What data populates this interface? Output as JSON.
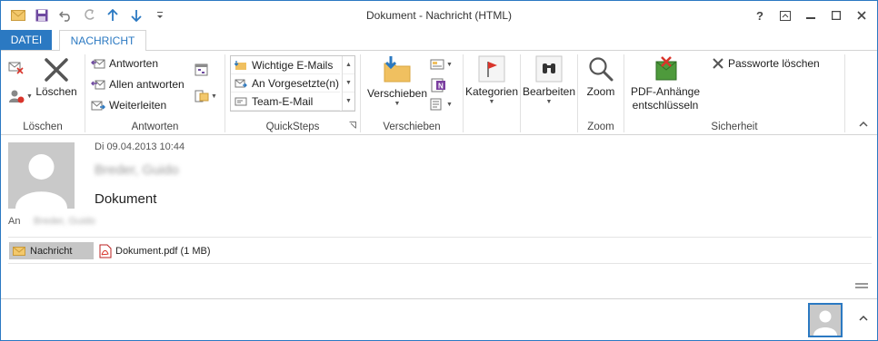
{
  "window": {
    "title": "Dokument - Nachricht (HTML)",
    "controls": {
      "help": "?",
      "restore_ribbon": "⇱",
      "minimize": "—",
      "maximize": "☐",
      "close": "✕"
    }
  },
  "tabs": {
    "file": "DATEI",
    "message": "NACHRICHT"
  },
  "ribbon": {
    "loeschen": {
      "delete_label": "Löschen",
      "group": "Löschen"
    },
    "antworten": {
      "reply": "Antworten",
      "reply_all": "Allen antworten",
      "forward": "Weiterleiten",
      "group": "Antworten"
    },
    "quicksteps": {
      "items": [
        "Wichtige E-Mails",
        "An Vorgesetzte(n)",
        "Team-E-Mail"
      ],
      "group": "QuickSteps"
    },
    "verschieben": {
      "move": "Verschieben",
      "group": "Verschieben"
    },
    "kategorien": {
      "label": "Kategorien"
    },
    "bearbeiten": {
      "label": "Bearbeiten"
    },
    "zoom": {
      "label": "Zoom",
      "group": "Zoom"
    },
    "sicherheit": {
      "pdf_line1": "PDF-Anhänge",
      "pdf_line2": "entschlüsseln",
      "passwords": "Passworte löschen",
      "group": "Sicherheit"
    }
  },
  "message": {
    "date": "Di 09.04.2013 10:44",
    "sender": "Breder, Guido",
    "subject": "Dokument",
    "to_label": "An",
    "to_value": "Breder, Guido",
    "attachments": {
      "message_tab": "Nachricht",
      "file": "Dokument.pdf (1 MB)"
    }
  },
  "colors": {
    "accent": "#2b79c2",
    "folder": "#f0c060",
    "flag": "#d9342b"
  }
}
